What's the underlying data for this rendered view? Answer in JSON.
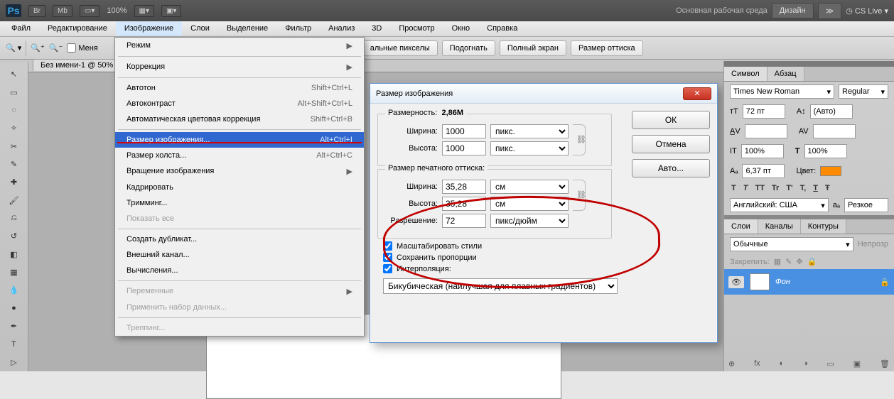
{
  "topbar": {
    "zoom": "100%",
    "workspace": "Основная рабочая среда",
    "design": "Дизайн",
    "cslive": "CS Live"
  },
  "menubar": [
    "Файл",
    "Редактирование",
    "Изображение",
    "Слои",
    "Выделение",
    "Фильтр",
    "Анализ",
    "3D",
    "Просмотр",
    "Окно",
    "Справка"
  ],
  "optbar_chk": "Меня",
  "optbar_btns": [
    "альные пикселы",
    "Подогнать",
    "Полный экран",
    "Размер оттиска"
  ],
  "doc_tab": "Без имени-1 @ 50%",
  "menu": {
    "items": [
      {
        "label": "Режим",
        "sub": true
      },
      {
        "sep": true
      },
      {
        "label": "Коррекция",
        "sub": true
      },
      {
        "sep": true
      },
      {
        "label": "Автотон",
        "sc": "Shift+Ctrl+L"
      },
      {
        "label": "Автоконтраст",
        "sc": "Alt+Shift+Ctrl+L"
      },
      {
        "label": "Автоматическая цветовая коррекция",
        "sc": "Shift+Ctrl+B"
      },
      {
        "sep": true
      },
      {
        "label": "Размер изображения...",
        "sc": "Alt+Ctrl+I",
        "hi": true
      },
      {
        "label": "Размер холста...",
        "sc": "Alt+Ctrl+C"
      },
      {
        "label": "Вращение изображения",
        "sub": true
      },
      {
        "label": "Кадрировать"
      },
      {
        "label": "Тримминг..."
      },
      {
        "label": "Показать все",
        "disabled": true
      },
      {
        "sep": true
      },
      {
        "label": "Создать дубликат..."
      },
      {
        "label": "Внешний канал..."
      },
      {
        "label": "Вычисления..."
      },
      {
        "sep": true
      },
      {
        "label": "Переменные",
        "sub": true,
        "disabled": true
      },
      {
        "label": "Применить набор данных...",
        "disabled": true
      },
      {
        "sep": true
      },
      {
        "label": "Треппинг...",
        "disabled": true
      }
    ]
  },
  "dialog": {
    "title": "Размер изображения",
    "dim_label": "Размерность:",
    "dim_value": "2,86M",
    "width_l": "Ширина:",
    "width_v": "1000",
    "width_u": "пикс.",
    "height_l": "Высота:",
    "height_v": "1000",
    "height_u": "пикс.",
    "print_legend": "Размер печатного оттиска:",
    "pwidth_l": "Ширина:",
    "pwidth_v": "35,28",
    "pwidth_u": "см",
    "pheight_l": "Высота:",
    "pheight_v": "35,28",
    "pheight_u": "см",
    "res_l": "Разрешение:",
    "res_v": "72",
    "res_u": "пикс/дюйм",
    "chk1": "Масштабировать стили",
    "chk2": "Сохранить пропорции",
    "chk3": "Интерполяция:",
    "interp": "Бикубическая (наилучшая для плавных градиентов)",
    "ok": "ОК",
    "cancel": "Отмена",
    "auto": "Авто..."
  },
  "right": {
    "tabs1": [
      "Символ",
      "Абзац"
    ],
    "font": "Times New Roman",
    "style": "Regular",
    "size": "72 пт",
    "leading": "(Авто)",
    "track": "100%",
    "track2": "100%",
    "kern": "6,37 пт",
    "color_l": "Цвет:",
    "lang": "Английский: США",
    "aa": "Резкое",
    "tabs2": [
      "Слои",
      "Каналы",
      "Контуры"
    ],
    "blend": "Обычные",
    "opacity": "Непрозр",
    "lock": "Закрепить:",
    "layer_name": "Фон",
    "tt_row": [
      "T",
      "T",
      "TT",
      "Tr",
      "T'",
      "T,",
      "T",
      "Ŧ"
    ]
  }
}
